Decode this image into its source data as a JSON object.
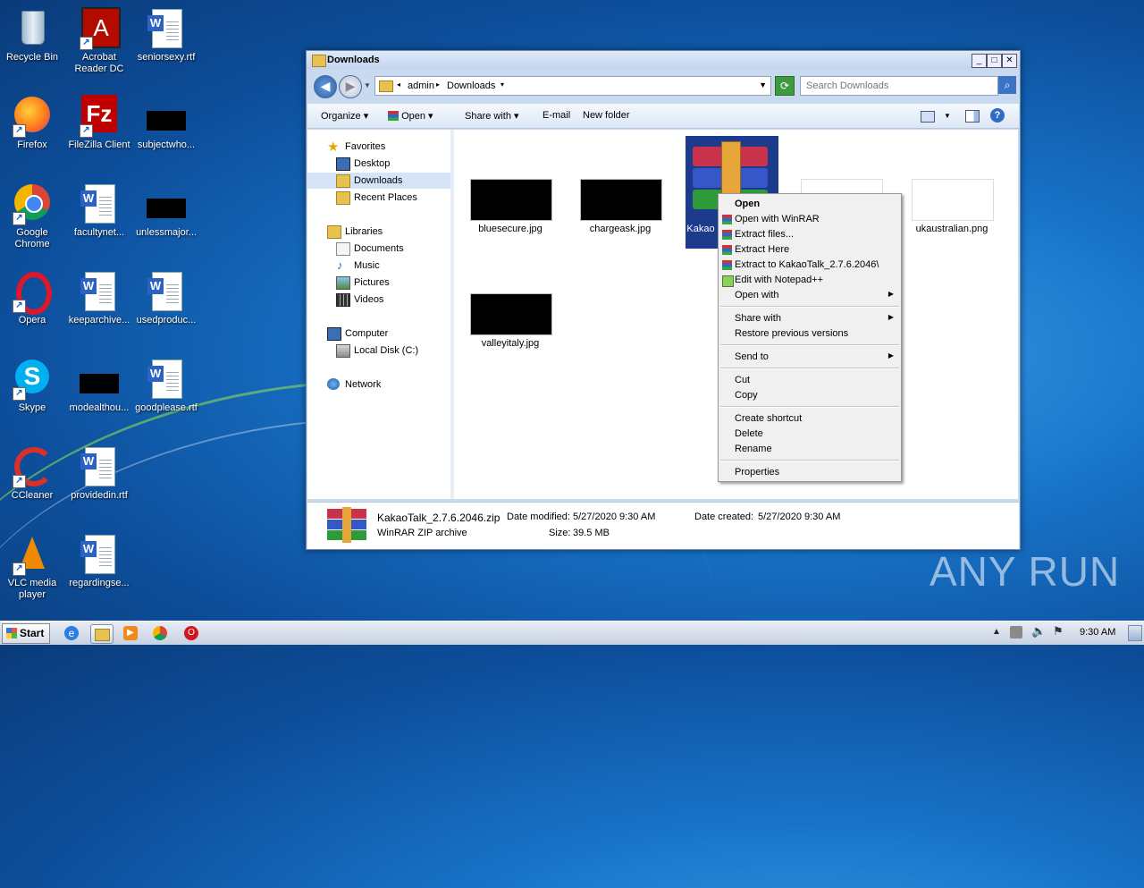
{
  "desktop": {
    "icons": [
      {
        "label": "Recycle Bin"
      },
      {
        "label": "Acrobat Reader DC"
      },
      {
        "label": "seniorsexy.rtf"
      },
      {
        "label": "Firefox"
      },
      {
        "label": "FileZilla Client"
      },
      {
        "label": "subjectwho..."
      },
      {
        "label": "Google Chrome"
      },
      {
        "label": "facultynet..."
      },
      {
        "label": "unlessmajor..."
      },
      {
        "label": "Opera"
      },
      {
        "label": "keeparchive..."
      },
      {
        "label": "usedproduc..."
      },
      {
        "label": "Skype"
      },
      {
        "label": "modealthou..."
      },
      {
        "label": "goodplease.rtf"
      },
      {
        "label": "CCleaner"
      },
      {
        "label": "providedin.rtf"
      },
      {
        "label": "VLC media player"
      },
      {
        "label": "regardingse..."
      }
    ]
  },
  "window": {
    "title": "Downloads",
    "breadcrumb": [
      "admin",
      "Downloads"
    ],
    "search_placeholder": "Search Downloads",
    "toolbar": {
      "organize": "Organize",
      "open": "Open",
      "share_with": "Share with",
      "email": "E-mail",
      "new_folder": "New folder"
    },
    "nav": {
      "favorites": "Favorites",
      "desktop": "Desktop",
      "downloads": "Downloads",
      "recent": "Recent Places",
      "libraries": "Libraries",
      "documents": "Documents",
      "music": "Music",
      "pictures": "Pictures",
      "videos": "Videos",
      "computer": "Computer",
      "local_disk": "Local Disk (C:)",
      "network": "Network"
    },
    "files": [
      {
        "name": "bluesecure.jpg"
      },
      {
        "name": "chargeask.jpg"
      },
      {
        "name": "Kakao"
      },
      {
        "name": "ukaustralian.png"
      },
      {
        "name": "valleyitaly.jpg"
      }
    ],
    "details": {
      "filename": "KakaoTalk_2.7.6.2046.zip",
      "modified_label": "Date modified:",
      "modified": "5/27/2020 9:30 AM",
      "created_label": "Date created:",
      "created": "5/27/2020 9:30 AM",
      "type": "WinRAR ZIP archive",
      "size_label": "Size:",
      "size": "39.5 MB"
    }
  },
  "context_menu": {
    "open": "Open",
    "open_winrar": "Open with WinRAR",
    "extract_files": "Extract files...",
    "extract_here": "Extract Here",
    "extract_to": "Extract to KakaoTalk_2.7.6.2046\\",
    "edit_npp": "Edit with Notepad++",
    "open_with": "Open with",
    "share_with": "Share with",
    "restore": "Restore previous versions",
    "send_to": "Send to",
    "cut": "Cut",
    "copy": "Copy",
    "create_shortcut": "Create shortcut",
    "delete": "Delete",
    "rename": "Rename",
    "properties": "Properties"
  },
  "taskbar": {
    "start": "Start",
    "clock": "9:30 AM"
  },
  "watermark": "ANY RUN"
}
